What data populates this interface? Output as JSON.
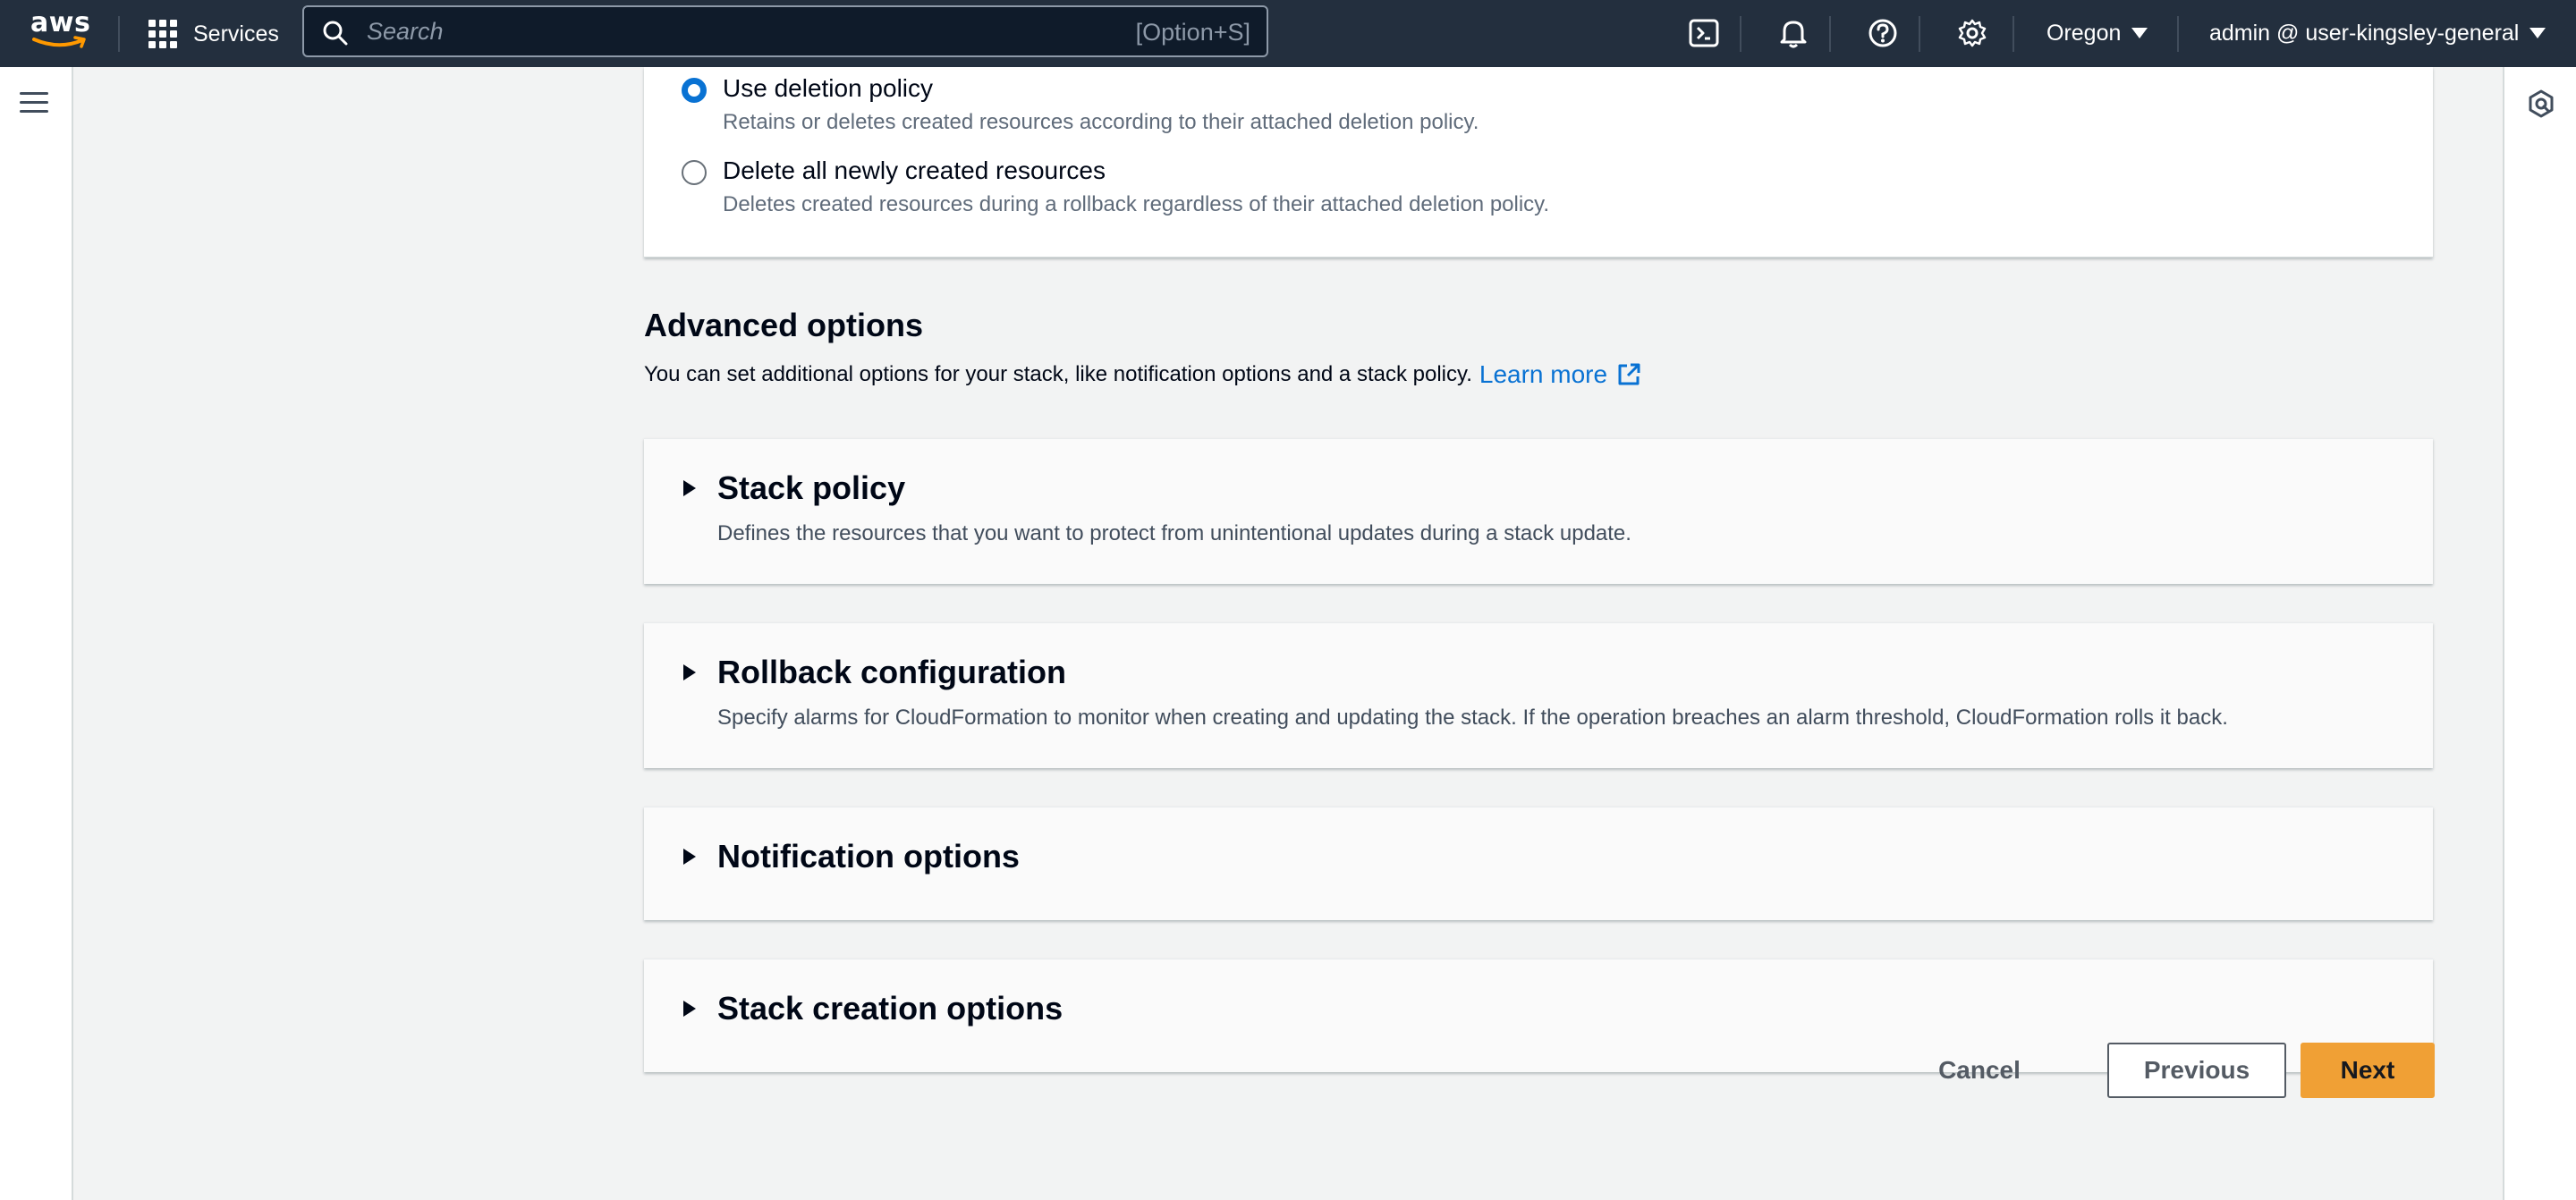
{
  "topnav": {
    "logo_text": "aws",
    "services_label": "Services",
    "search_placeholder": "Search",
    "search_shortcut": "[Option+S]",
    "icons": [
      "cloudshell-icon",
      "bell-icon",
      "help-icon",
      "gear-icon"
    ],
    "region": "Oregon",
    "account": "admin @ user-kingsley-general",
    "colors": {
      "bar": "#232f3e",
      "logo_smile": "#ff9900"
    }
  },
  "deletion": {
    "options": [
      {
        "label": "Use deletion policy",
        "description": "Retains or deletes created resources according to their attached deletion policy.",
        "selected": true
      },
      {
        "label": "Delete all newly created resources",
        "description": "Deletes created resources during a rollback regardless of their attached deletion policy.",
        "selected": false
      }
    ]
  },
  "advanced": {
    "title": "Advanced options",
    "description": "You can set additional options for your stack, like notification options and a stack policy.",
    "learn_more": "Learn more",
    "sections": [
      {
        "title": "Stack policy",
        "description": "Defines the resources that you want to protect from unintentional updates during a stack update.",
        "expanded": false
      },
      {
        "title": "Rollback configuration",
        "description": "Specify alarms for CloudFormation to monitor when creating and updating the stack. If the operation breaches an alarm threshold, CloudFormation rolls it back.",
        "expanded": false
      },
      {
        "title": "Notification options",
        "expanded": false
      },
      {
        "title": "Stack creation options",
        "expanded": false
      }
    ]
  },
  "footer": {
    "cancel": "Cancel",
    "previous": "Previous",
    "next": "Next",
    "colors": {
      "primary": "#f0a035",
      "link": "#0972d3"
    }
  }
}
